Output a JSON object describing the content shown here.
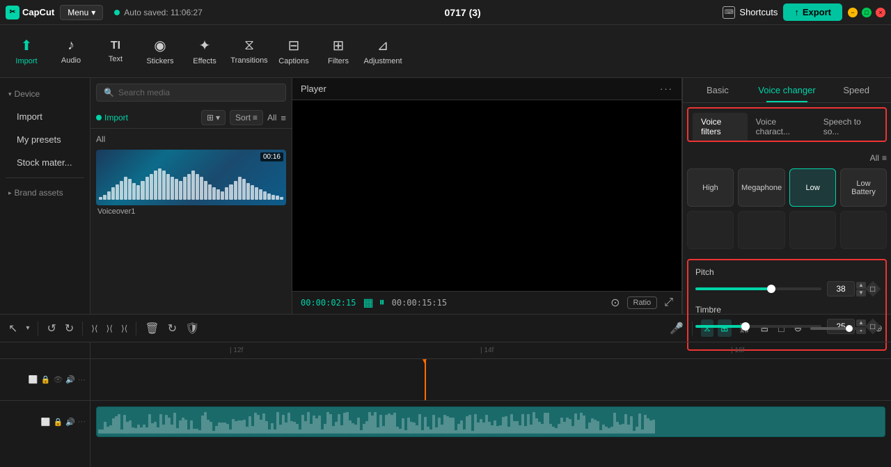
{
  "app": {
    "name": "CapCut",
    "logo_text": "CC"
  },
  "topbar": {
    "menu_label": "Menu",
    "auto_save_label": "Auto saved: 11:06:27",
    "title": "0717 (3)",
    "shortcuts_label": "Shortcuts",
    "export_label": "Export",
    "menu_chevron": "▾"
  },
  "toolbar": {
    "items": [
      {
        "id": "import",
        "label": "Import",
        "icon": "⬆",
        "active": true
      },
      {
        "id": "audio",
        "label": "Audio",
        "icon": "♪"
      },
      {
        "id": "text",
        "label": "Text",
        "icon": "TI"
      },
      {
        "id": "stickers",
        "label": "Stickers",
        "icon": "◉"
      },
      {
        "id": "effects",
        "label": "Effects",
        "icon": "✦"
      },
      {
        "id": "transitions",
        "label": "Transitions",
        "icon": "⧖"
      },
      {
        "id": "captions",
        "label": "Captions",
        "icon": "⊟"
      },
      {
        "id": "filters",
        "label": "Filters",
        "icon": "⊞"
      },
      {
        "id": "adjustment",
        "label": "Adjustment",
        "icon": "⊿"
      }
    ]
  },
  "left_panel": {
    "device_label": "Device",
    "items": [
      {
        "id": "import",
        "label": "Import"
      },
      {
        "id": "presets",
        "label": "My presets"
      },
      {
        "id": "stock",
        "label": "Stock mater..."
      }
    ],
    "brand_assets_label": "Brand assets"
  },
  "media_panel": {
    "search_placeholder": "Search media",
    "import_label": "Import",
    "grid_icon": "⊞",
    "sort_label": "Sort",
    "sort_icon": "≡",
    "all_label": "All",
    "filter_icon": "≡",
    "all_tag": "All",
    "items": [
      {
        "name": "Voiceover1",
        "duration": "00:16",
        "waveform_bars": [
          3,
          5,
          8,
          12,
          15,
          18,
          22,
          20,
          16,
          14,
          18,
          22,
          25,
          28,
          30,
          28,
          25,
          22,
          20,
          18,
          22,
          25,
          28,
          25,
          22,
          18,
          15,
          12,
          10,
          8,
          12,
          15,
          18,
          22,
          20,
          16,
          14,
          12,
          10,
          8,
          6,
          5,
          4,
          3
        ]
      }
    ]
  },
  "player": {
    "title": "Player",
    "menu_dots": "···",
    "time_current": "00:00:02:15",
    "time_total": "00:00:15:15",
    "ratio_label": "Ratio"
  },
  "right_panel": {
    "tabs": [
      {
        "id": "basic",
        "label": "Basic"
      },
      {
        "id": "voice_changer",
        "label": "Voice changer",
        "active": true
      },
      {
        "id": "speed",
        "label": "Speed"
      }
    ],
    "sub_tabs": [
      {
        "id": "voice_filters",
        "label": "Voice filters",
        "active": true
      },
      {
        "id": "voice_characters",
        "label": "Voice charact..."
      },
      {
        "id": "speech_to_song",
        "label": "Speech to so..."
      }
    ],
    "all_label": "All",
    "filter_icon": "≡",
    "voice_items": [
      {
        "id": "high",
        "label": "High"
      },
      {
        "id": "megaphone",
        "label": "Megaphone"
      },
      {
        "id": "low",
        "label": "Low",
        "selected": true
      },
      {
        "id": "low_battery",
        "label": "Low Battery"
      }
    ],
    "pitch": {
      "label": "Pitch",
      "value": 38,
      "percent": 60
    },
    "timbre": {
      "label": "Timbre",
      "value": 25,
      "percent": 40
    }
  },
  "timeline": {
    "ruler_marks": [
      "| 12f",
      "| 14f",
      "| 16f"
    ],
    "tools": [
      {
        "id": "select",
        "icon": "↖",
        "label": "select"
      },
      {
        "id": "undo",
        "icon": "↺",
        "label": "undo"
      },
      {
        "id": "redo",
        "icon": "↻",
        "label": "redo"
      },
      {
        "id": "split",
        "icon": "⟩⟨",
        "label": "split"
      },
      {
        "id": "split2",
        "icon": "⟩⟨",
        "label": "split2"
      },
      {
        "id": "split3",
        "icon": "⟩⟨",
        "label": "split3"
      },
      {
        "id": "delete",
        "icon": "🗑",
        "label": "delete"
      },
      {
        "id": "loop",
        "icon": "↻",
        "label": "loop"
      },
      {
        "id": "shield",
        "icon": "🛡",
        "label": "shield"
      }
    ],
    "track1_icons": [
      "⬜",
      "🔒",
      "👁",
      "🔊",
      "···"
    ],
    "track2_icons": [
      "⬜",
      "🔒",
      "🔊",
      "···"
    ]
  }
}
